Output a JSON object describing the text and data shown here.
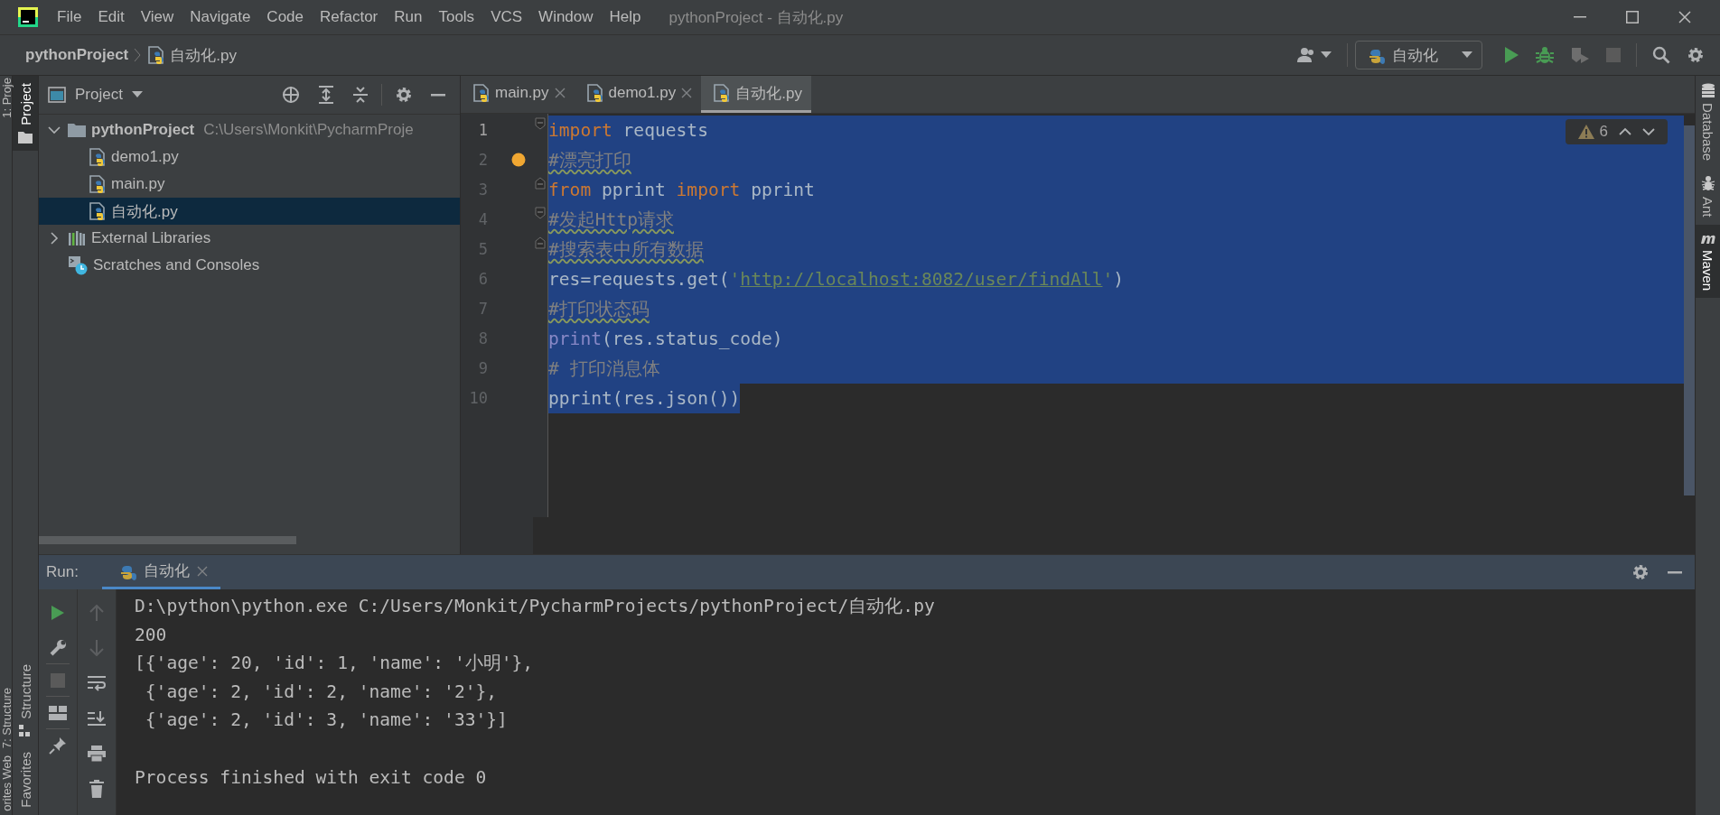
{
  "window": {
    "title": "pythonProject - 自动化.py"
  },
  "menu": [
    "File",
    "Edit",
    "View",
    "Navigate",
    "Code",
    "Refactor",
    "Run",
    "Tools",
    "VCS",
    "Window",
    "Help"
  ],
  "breadcrumb": [
    "pythonProject",
    "自动化.py"
  ],
  "toolbar": {
    "run_config": "自动化"
  },
  "tool_strips": {
    "left_edge": [
      "1: Proje",
      "7: Structure",
      "Web",
      "orites"
    ],
    "left": [
      {
        "label": "Project",
        "selected": true
      },
      {
        "label": "Structure",
        "selected": false
      },
      {
        "label": "Favorites",
        "selected": false
      }
    ],
    "right": [
      {
        "label": "Database",
        "selected": false
      },
      {
        "label": "Ant",
        "selected": false
      },
      {
        "label": "Maven",
        "selected": true
      }
    ]
  },
  "project": {
    "title": "Project",
    "tree": [
      {
        "name": "pythonProject",
        "path": "C:\\Users\\Monkit\\PycharmProje",
        "kind": "folder",
        "expanded": true,
        "selected": false,
        "children": [
          {
            "name": "demo1.py",
            "kind": "python-file",
            "selected": false
          },
          {
            "name": "main.py",
            "kind": "python-file",
            "selected": false
          },
          {
            "name": "自动化.py",
            "kind": "python-file",
            "selected": true
          }
        ]
      },
      {
        "name": "External Libraries",
        "kind": "library",
        "expanded": false,
        "selected": false
      },
      {
        "name": "Scratches and Consoles",
        "kind": "scratches",
        "selected": false
      }
    ]
  },
  "editor": {
    "tabs": [
      {
        "label": "main.py",
        "selected": false
      },
      {
        "label": "demo1.py",
        "selected": false
      },
      {
        "label": "自动化.py",
        "selected": true
      }
    ],
    "inspections": {
      "warnings": "6"
    },
    "lines": [
      {
        "number": "1",
        "current": true,
        "selected": true,
        "fold_start": true,
        "fold_end": false,
        "tokens": [
          {
            "kind": "keyword",
            "text": "import"
          },
          {
            "kind": "plain",
            "text": " requests"
          }
        ]
      },
      {
        "number": "2",
        "current": false,
        "selected": true,
        "fold_start": false,
        "fold_end": false,
        "bulb": true,
        "tokens": [
          {
            "kind": "typo-comment",
            "text": "#漂亮打印"
          }
        ]
      },
      {
        "number": "3",
        "current": false,
        "selected": true,
        "fold_start": false,
        "fold_end": true,
        "tokens": [
          {
            "kind": "keyword",
            "text": "from"
          },
          {
            "kind": "plain",
            "text": " pprint "
          },
          {
            "kind": "keyword",
            "text": "import"
          },
          {
            "kind": "plain",
            "text": " pprint"
          }
        ]
      },
      {
        "number": "4",
        "current": false,
        "selected": true,
        "fold_start": true,
        "fold_end": false,
        "tokens": [
          {
            "kind": "typo-comment",
            "text": "#发起Http请求"
          }
        ]
      },
      {
        "number": "5",
        "current": false,
        "selected": true,
        "fold_start": false,
        "fold_end": true,
        "tokens": [
          {
            "kind": "typo-comment",
            "text": "#搜索表中所有数据"
          }
        ]
      },
      {
        "number": "6",
        "current": false,
        "selected": true,
        "fold_start": false,
        "fold_end": false,
        "tokens": [
          {
            "kind": "plain",
            "text": "res=requests.get("
          },
          {
            "kind": "string",
            "text": "'"
          },
          {
            "kind": "link",
            "text": "http://localhost:8082/user/findAll"
          },
          {
            "kind": "string",
            "text": "'"
          },
          {
            "kind": "plain",
            "text": ")"
          }
        ]
      },
      {
        "number": "7",
        "current": false,
        "selected": true,
        "fold_start": false,
        "fold_end": false,
        "tokens": [
          {
            "kind": "typo-comment",
            "text": "#打印状态码"
          }
        ]
      },
      {
        "number": "8",
        "current": false,
        "selected": true,
        "fold_start": false,
        "fold_end": false,
        "tokens": [
          {
            "kind": "builtin",
            "text": "print"
          },
          {
            "kind": "plain",
            "text": "(res.status_code)"
          }
        ]
      },
      {
        "number": "9",
        "current": false,
        "selected": true,
        "fold_start": false,
        "fold_end": false,
        "tokens": [
          {
            "kind": "comment",
            "text": "# 打印消息体"
          }
        ]
      },
      {
        "number": "10",
        "current": false,
        "selected": true,
        "fold_start": false,
        "fold_end": false,
        "tokens": [
          {
            "kind": "plain",
            "text": "pprint(res.json())"
          }
        ]
      }
    ]
  },
  "run": {
    "label": "Run:",
    "tab": "自动化",
    "console": [
      {
        "kind": "command",
        "text": "D:\\python\\python.exe C:/Users/Monkit/PycharmProjects/pythonProject/自动化.py"
      },
      {
        "kind": "output",
        "text": "200"
      },
      {
        "kind": "output",
        "text": "[{'age': 20, 'id': 1, 'name': '小明'},"
      },
      {
        "kind": "output",
        "text": " {'age': 2, 'id': 2, 'name': '2'},"
      },
      {
        "kind": "output",
        "text": " {'age': 2, 'id': 3, 'name': '33'}]"
      },
      {
        "kind": "exit",
        "text": "Process finished with exit code 0"
      }
    ]
  }
}
